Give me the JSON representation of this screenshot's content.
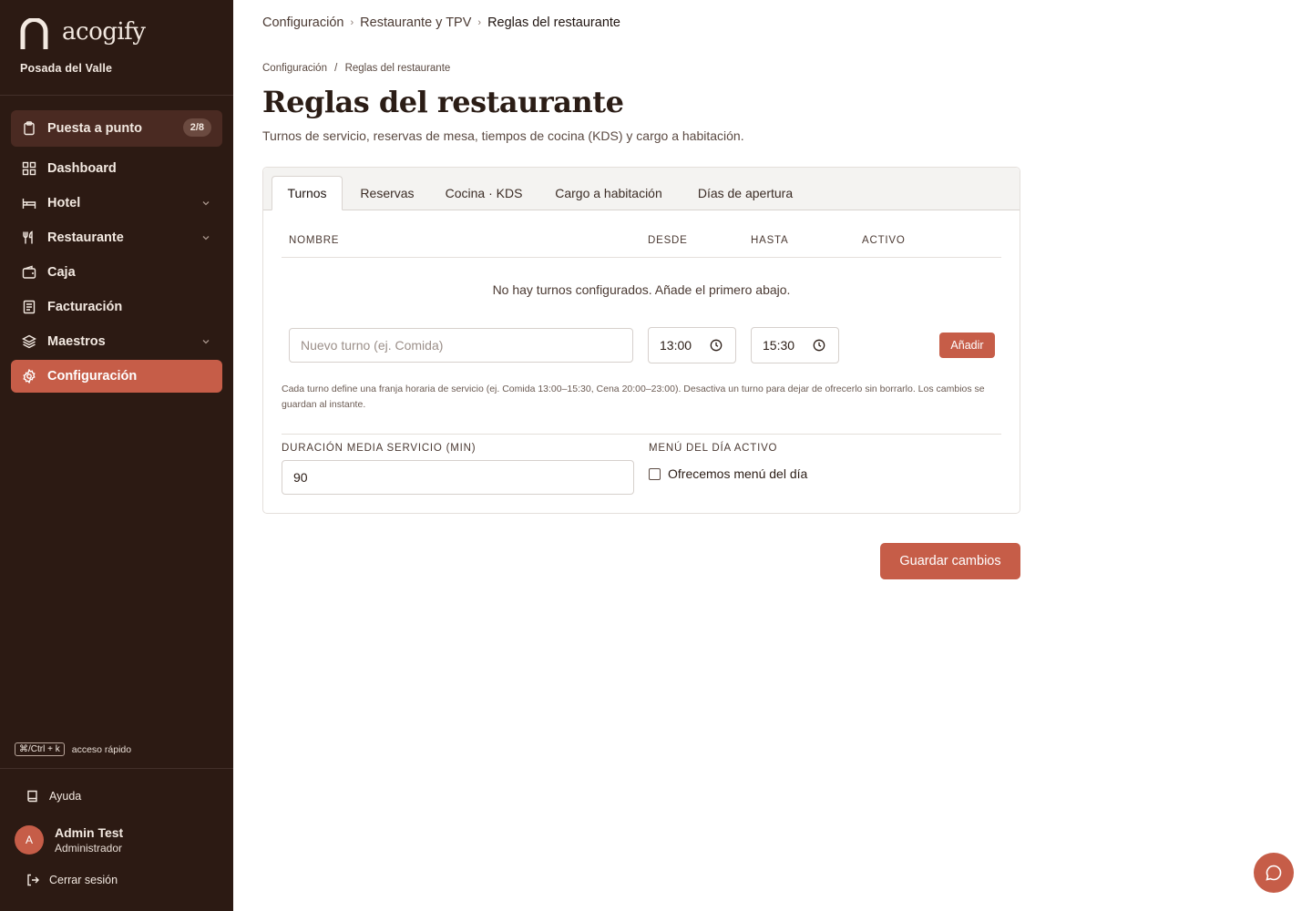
{
  "brand": {
    "name": "acogify",
    "property": "Posada del Valle"
  },
  "sidebar": {
    "setup": {
      "label": "Puesta a punto",
      "badge": "2/8"
    },
    "items": [
      {
        "label": "Dashboard",
        "icon": "grid-icon"
      },
      {
        "label": "Hotel",
        "icon": "bed-icon",
        "expandable": true
      },
      {
        "label": "Restaurante",
        "icon": "utensils-icon",
        "expandable": true
      },
      {
        "label": "Caja",
        "icon": "wallet-icon"
      },
      {
        "label": "Facturación",
        "icon": "receipt-icon"
      },
      {
        "label": "Maestros",
        "icon": "layers-icon",
        "expandable": true
      },
      {
        "label": "Configuración",
        "icon": "gear-icon",
        "active": true
      }
    ],
    "shortcut": {
      "key": "⌘/Ctrl + k",
      "label": "acceso rápido"
    },
    "help": "Ayuda",
    "user": {
      "initial": "A",
      "name": "Admin Test",
      "role": "Administrador"
    },
    "logout": "Cerrar sesión"
  },
  "breadcrumb_top": [
    "Configuración",
    "Restaurante y TPV",
    "Reglas del restaurante"
  ],
  "breadcrumb_sub": [
    "Configuración",
    "Reglas del restaurante"
  ],
  "page": {
    "title": "Reglas del restaurante",
    "subtitle": "Turnos de servicio, reservas de mesa, tiempos de cocina (KDS) y cargo a habitación."
  },
  "tabs": [
    "Turnos",
    "Reservas",
    "Cocina · KDS",
    "Cargo a habitación",
    "Días de apertura"
  ],
  "active_tab": "Turnos",
  "shifts": {
    "columns": [
      "NOMBRE",
      "DESDE",
      "HASTA",
      "ACTIVO"
    ],
    "empty": "No hay turnos configurados. Añade el primero abajo.",
    "new_placeholder": "Nuevo turno (ej. Comida)",
    "from": "13:00",
    "to": "15:30",
    "add_label": "Añadir",
    "hint": "Cada turno define una franja horaria de servicio (ej. Comida 13:00–15:30, Cena 20:00–23:00). Desactiva un turno para dejar de ofrecerlo sin borrarlo. Los cambios se guardan al instante."
  },
  "settings": {
    "duration_label": "DURACIÓN MEDIA SERVICIO (MIN)",
    "duration_value": "90",
    "menu_label": "MENÚ DEL DÍA ACTIVO",
    "menu_checkbox": "Ofrecemos menú del día",
    "menu_checked": false
  },
  "save_label": "Guardar cambios",
  "colors": {
    "sidebar": "#2c1a13",
    "accent": "#c65d48",
    "setup_bg": "#4a2a22"
  }
}
